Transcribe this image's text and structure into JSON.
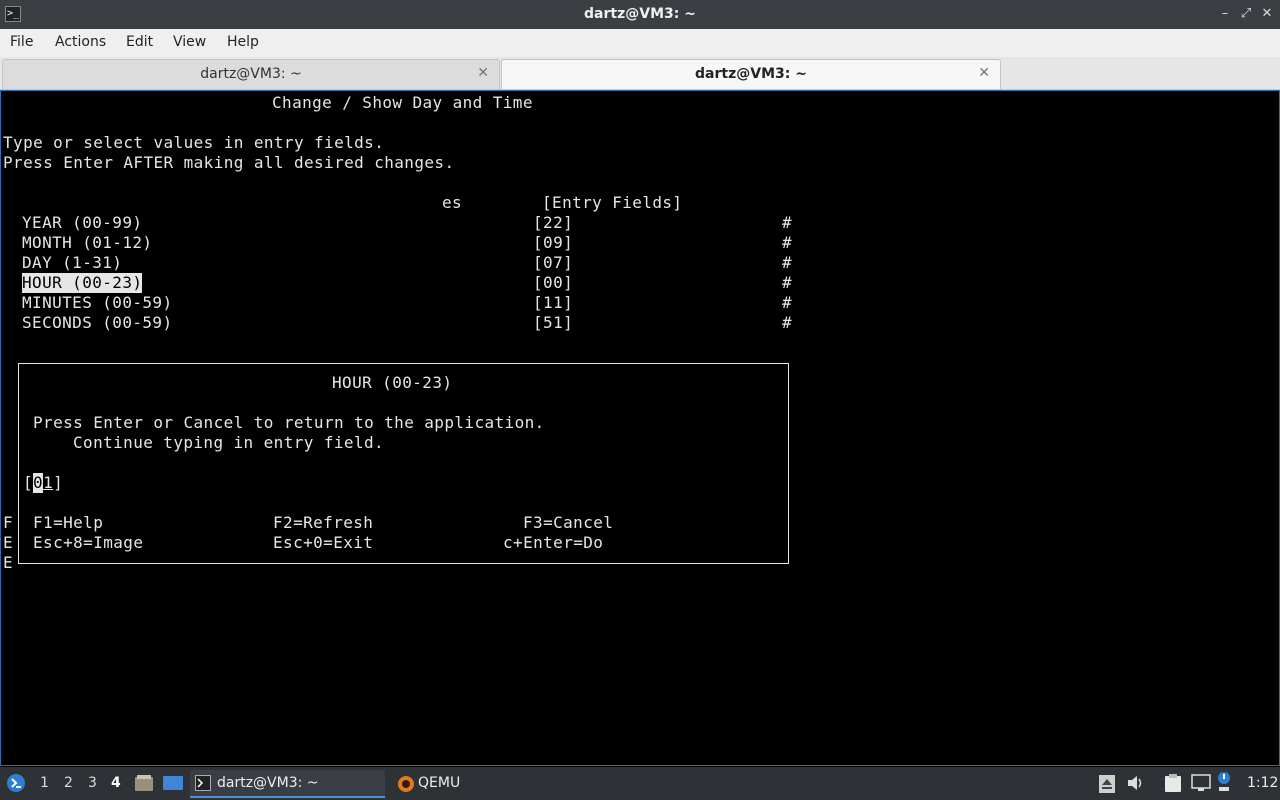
{
  "window": {
    "title": "dartz@VM3: ~",
    "controls": [
      "–",
      "⤢",
      "✕"
    ]
  },
  "menu": [
    "File",
    "Actions",
    "Edit",
    "View",
    "Help"
  ],
  "tabs": [
    {
      "label": "dartz@VM3: ~",
      "active": false
    },
    {
      "label": "dartz@VM3: ~",
      "active": true
    }
  ],
  "terminal": {
    "screen_title": "Change / Show Day and Time",
    "instr1": "Type or select values in entry fields.",
    "instr2": "Press Enter AFTER making all desired changes.",
    "col_fragment": "es",
    "entry_header": "[Entry Fields]",
    "fields": [
      {
        "label": "YEAR (00-99)",
        "value": "[22]",
        "mark": "#"
      },
      {
        "label": "MONTH (01-12)",
        "value": "[09]",
        "mark": "#"
      },
      {
        "label": "DAY (1-31)",
        "value": "[07]",
        "mark": "#"
      },
      {
        "label": "HOUR (00-23)",
        "value": "[00]",
        "mark": "#"
      },
      {
        "label": "MINUTES (00-59)",
        "value": "[11]",
        "mark": "#"
      },
      {
        "label": "SECONDS (00-59)",
        "value": "[51]",
        "mark": "#"
      }
    ],
    "left_fragments": [
      "F",
      "E",
      "E"
    ],
    "popup": {
      "title": "HOUR (00-23)",
      "line1": "Press Enter or Cancel to return to the application.",
      "line2": "Continue typing in entry field.",
      "input_open": "[",
      "input_cursor": "0",
      "input_rest": "1",
      "input_close": "]",
      "keys": [
        [
          "F1=Help",
          "F2=Refresh",
          "F3=Cancel"
        ],
        [
          "Esc+8=Image",
          "Esc+0=Exit",
          "c+Enter=Do"
        ]
      ]
    }
  },
  "taskbar": {
    "workspaces": [
      "1",
      "2",
      "3",
      "4"
    ],
    "active_workspace": "4",
    "tasks": [
      "dartz@VM3: ~",
      "QEMU"
    ],
    "clock": "1:12"
  }
}
